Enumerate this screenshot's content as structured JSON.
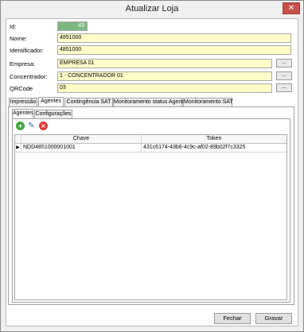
{
  "window": {
    "title": "Atualizar Loja",
    "close_glyph": "✕"
  },
  "form": {
    "id": {
      "label": "Id:",
      "value": "43"
    },
    "nome": {
      "label": "Nome:",
      "value": "4851000"
    },
    "identificador": {
      "label": "Identificador:",
      "value": "4851000"
    },
    "empresa": {
      "label": "Empresa:",
      "value": "EMPRESA 01",
      "button": "..."
    },
    "concentrador": {
      "label": "Concentrador:",
      "value": "1 - CONCENTRADOR 01",
      "button": "..."
    },
    "qrcode": {
      "label": "QRCode",
      "value": "03",
      "button": "..."
    }
  },
  "tabs": [
    {
      "label": "Impressão"
    },
    {
      "label": "Agentes"
    },
    {
      "label": "Contingência SAT"
    },
    {
      "label": "Monitoramento status Agente"
    },
    {
      "label": "Monitoramento SAT"
    }
  ],
  "active_tab": "Agentes",
  "subtabs": [
    {
      "label": "Agentes"
    },
    {
      "label": "Configurações"
    }
  ],
  "toolbar": {
    "add_icon": "add-icon",
    "edit_icon": "edit-icon",
    "delete_icon": "delete-icon"
  },
  "grid": {
    "columns": [
      "Chave",
      "Token"
    ],
    "rows": [
      {
        "indicator": "▶",
        "chave": "NDD4851000001001",
        "token": "431c6174-43b6-4c9c-af02-89b02f7c3325"
      }
    ]
  },
  "footer": {
    "close_label": "Fechar",
    "save_label": "Gravar"
  }
}
